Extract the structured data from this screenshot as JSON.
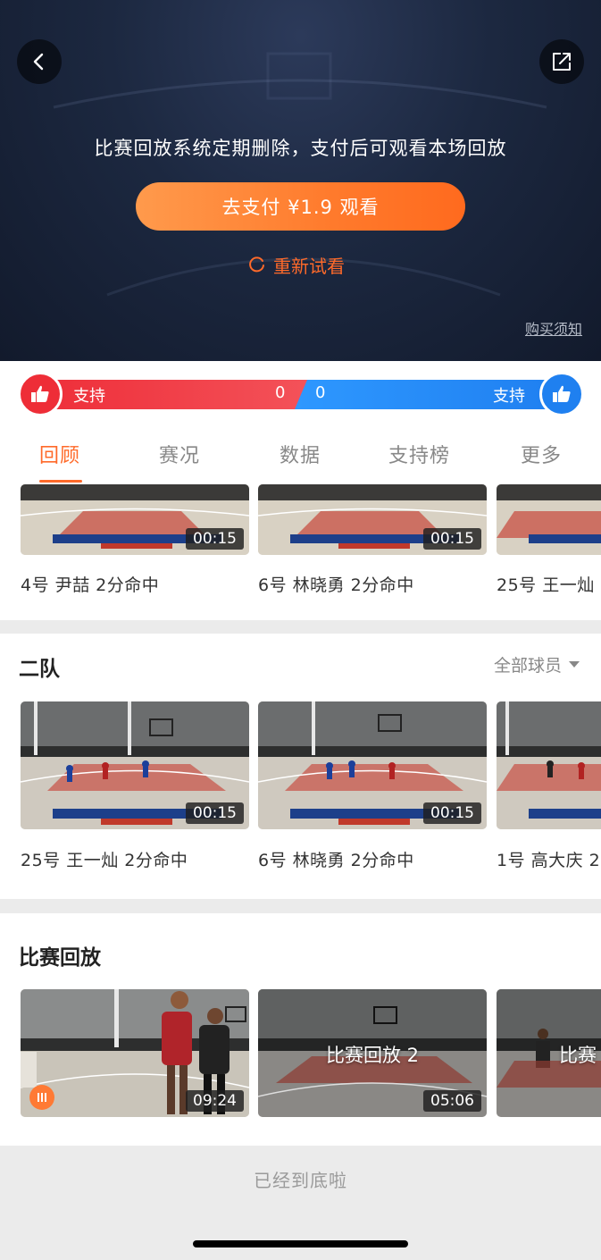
{
  "header": {
    "paywall_message": "比赛回放系统定期删除，支付后可观看本场回放",
    "pay_button_label": "去支付 ¥1.9 观看",
    "retry_label": "重新试看",
    "purchase_notice": "购买须知"
  },
  "support": {
    "left_label": "支持",
    "left_count": "0",
    "right_label": "支持",
    "right_count": "0",
    "left_color": "#ee2e39",
    "right_color": "#1f80f0"
  },
  "tabs": [
    {
      "label": "回顾",
      "active": true
    },
    {
      "label": "赛况",
      "active": false
    },
    {
      "label": "数据",
      "active": false
    },
    {
      "label": "支持榜",
      "active": false
    },
    {
      "label": "更多",
      "active": false
    }
  ],
  "team1_clips": [
    {
      "duration": "00:15",
      "caption": "4号 尹喆 2分命中"
    },
    {
      "duration": "00:15",
      "caption": "6号 林晓勇 2分命中"
    },
    {
      "duration": "",
      "caption": "25号 王一灿"
    }
  ],
  "team2": {
    "title": "二队",
    "filter_label": "全部球员",
    "clips": [
      {
        "duration": "00:15",
        "caption": "25号 王一灿 2分命中"
      },
      {
        "duration": "00:15",
        "caption": "6号 林晓勇 2分命中"
      },
      {
        "duration": "",
        "caption": "1号 高大庆 2"
      }
    ]
  },
  "replays": {
    "title": "比赛回放",
    "items": [
      {
        "duration": "09:24",
        "label": ""
      },
      {
        "duration": "05:06",
        "label": "比赛回放 2"
      },
      {
        "duration": "",
        "label": "比赛"
      }
    ]
  },
  "footer": {
    "end_text": "已经到底啦"
  },
  "icons": {
    "back": "chevron-left-icon",
    "share": "share-icon",
    "retry": "refresh-icon",
    "support": "thumbs-up-icon",
    "pause": "pause-icon"
  },
  "accent_color": "#ff6a2a"
}
